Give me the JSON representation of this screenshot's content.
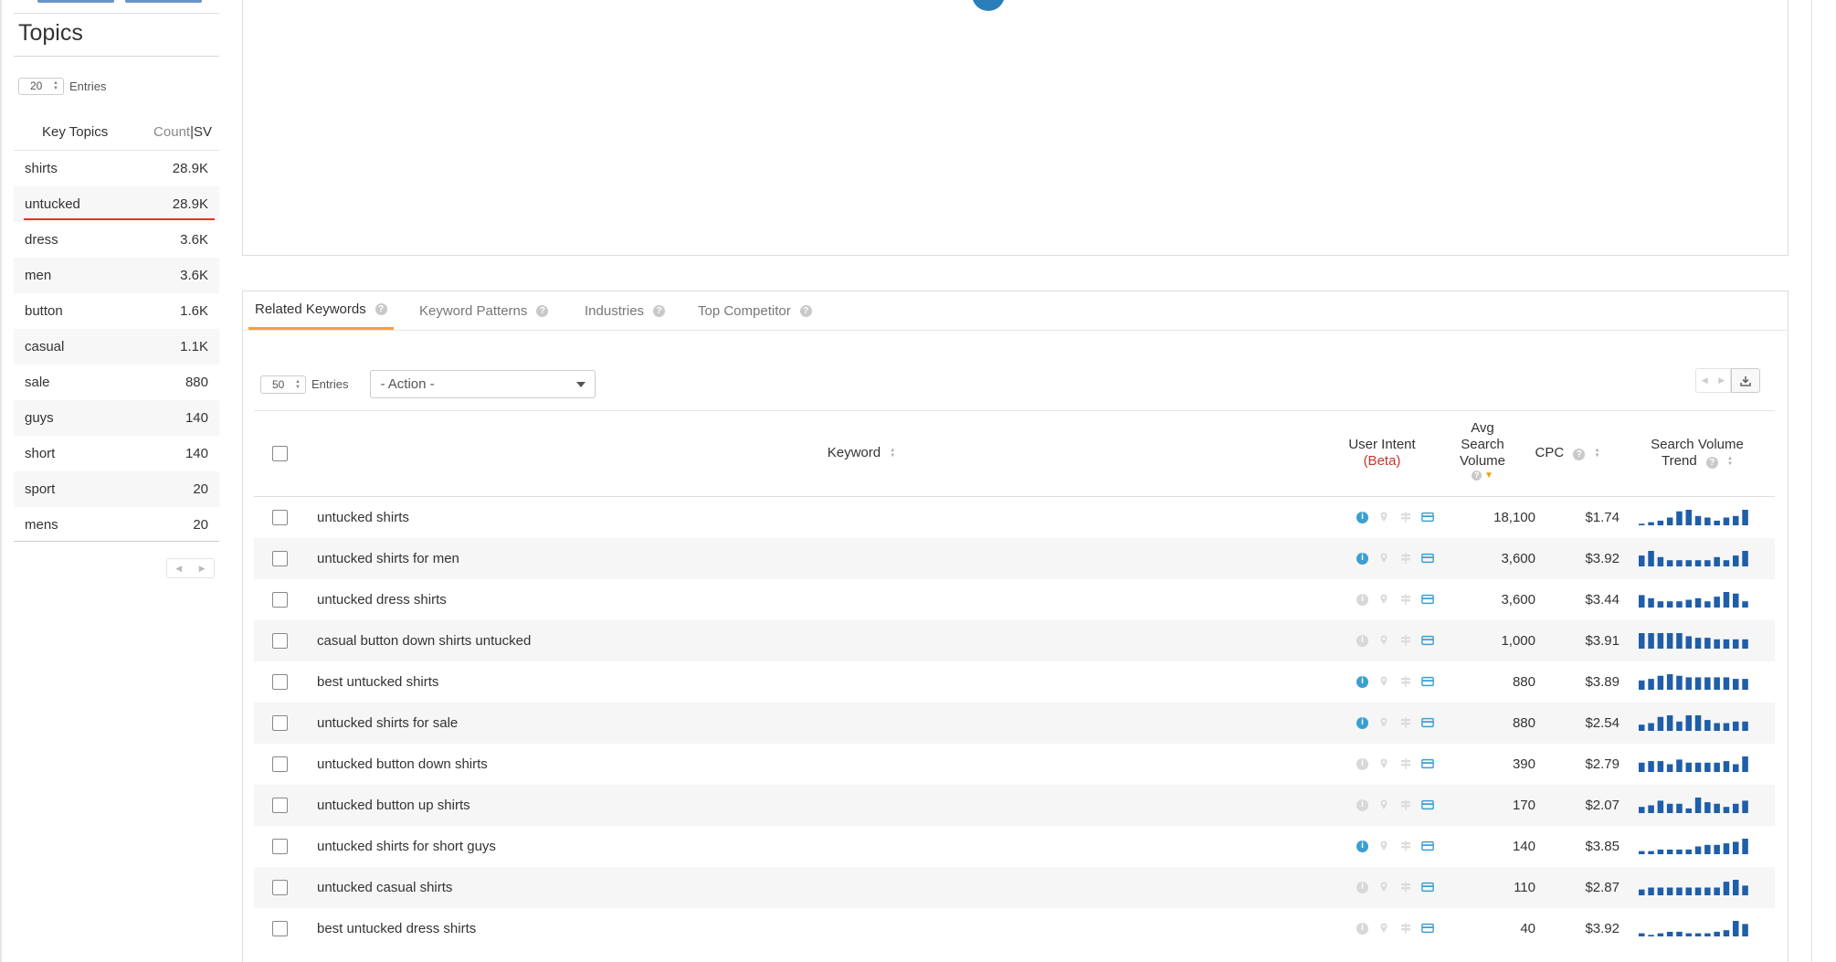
{
  "sidebar": {
    "title": "Topics",
    "entries_value": "20",
    "entries_label": "Entries",
    "col_key": "Key Topics",
    "col_count": "Count",
    "col_sep": "|",
    "col_sv": "SV",
    "topics": [
      {
        "name": "shirts",
        "count": "28.9K"
      },
      {
        "name": "untucked",
        "count": "28.9K",
        "highlight": true
      },
      {
        "name": "dress",
        "count": "3.6K"
      },
      {
        "name": "men",
        "count": "3.6K"
      },
      {
        "name": "button",
        "count": "1.6K"
      },
      {
        "name": "casual",
        "count": "1.1K"
      },
      {
        "name": "sale",
        "count": "880"
      },
      {
        "name": "guys",
        "count": "140"
      },
      {
        "name": "short",
        "count": "140"
      },
      {
        "name": "sport",
        "count": "20"
      },
      {
        "name": "mens",
        "count": "20"
      }
    ],
    "pager_prev": "◀",
    "pager_next": "▶"
  },
  "tabs": [
    {
      "label": "Related Keywords",
      "active": true
    },
    {
      "label": "Keyword Patterns"
    },
    {
      "label": "Industries"
    },
    {
      "label": "Top Competitor"
    }
  ],
  "controls": {
    "entries_value": "50",
    "entries_label": "Entries",
    "action_label": "- Action -"
  },
  "table": {
    "col_keyword": "Keyword",
    "col_intent": "User Intent",
    "col_intent_beta": "(Beta)",
    "col_avg_1": "Avg",
    "col_avg_2": "Search",
    "col_avg_3": "Volume",
    "col_cpc": "CPC",
    "col_trend_1": "Search Volume",
    "col_trend_2": "Trend",
    "rows": [
      {
        "keyword": "untucked shirts",
        "info": true,
        "volume": "18,100",
        "cpc": "$1.74",
        "trend": [
          1,
          2,
          3,
          5,
          9,
          10,
          6,
          5,
          3,
          5,
          6,
          10
        ]
      },
      {
        "keyword": "untucked shirts for men",
        "info": true,
        "volume": "3,600",
        "cpc": "$3.92",
        "trend": [
          7,
          10,
          6,
          4,
          4,
          4,
          4,
          4,
          6,
          4,
          7,
          10
        ]
      },
      {
        "keyword": "untucked dress shirts",
        "info": false,
        "volume": "3,600",
        "cpc": "$3.44",
        "trend": [
          8,
          6,
          4,
          4,
          4,
          5,
          6,
          4,
          7,
          10,
          9,
          4
        ]
      },
      {
        "keyword": "casual button down shirts untucked",
        "info": false,
        "volume": "1,000",
        "cpc": "$3.91",
        "trend": [
          10,
          10,
          10,
          10,
          10,
          8,
          7,
          7,
          6,
          6,
          6,
          6
        ]
      },
      {
        "keyword": "best untucked shirts",
        "info": true,
        "volume": "880",
        "cpc": "$3.89",
        "trend": [
          6,
          7,
          9,
          10,
          9,
          8,
          8,
          8,
          8,
          8,
          7,
          7
        ]
      },
      {
        "keyword": "untucked shirts for sale",
        "info": true,
        "volume": "880",
        "cpc": "$2.54",
        "trend": [
          4,
          5,
          9,
          10,
          6,
          10,
          10,
          7,
          5,
          5,
          6,
          6
        ]
      },
      {
        "keyword": "untucked button down shirts",
        "info": false,
        "volume": "390",
        "cpc": "$2.79",
        "trend": [
          6,
          7,
          7,
          5,
          8,
          6,
          6,
          6,
          6,
          7,
          5,
          10
        ]
      },
      {
        "keyword": "untucked button up shirts",
        "info": false,
        "volume": "170",
        "cpc": "$2.07",
        "trend": [
          4,
          5,
          8,
          6,
          6,
          3,
          10,
          7,
          6,
          4,
          6,
          8
        ]
      },
      {
        "keyword": "untucked shirts for short guys",
        "info": true,
        "volume": "140",
        "cpc": "$3.85",
        "trend": [
          2,
          2,
          3,
          3,
          3,
          3,
          5,
          6,
          6,
          7,
          8,
          10
        ]
      },
      {
        "keyword": "untucked casual shirts",
        "info": false,
        "volume": "110",
        "cpc": "$2.87",
        "trend": [
          3,
          4,
          4,
          4,
          4,
          4,
          4,
          4,
          4,
          7,
          8,
          5
        ]
      },
      {
        "keyword": "best untucked dress shirts",
        "info": false,
        "volume": "40",
        "cpc": "$3.92",
        "trend": [
          2,
          1,
          2,
          3,
          3,
          2,
          2,
          2,
          3,
          4,
          10,
          8
        ]
      }
    ]
  },
  "colors": {
    "accent": "#f0a23a",
    "highlight_underline": "#e8312a",
    "trend_bar": "#1f5ea8",
    "info_icon": "#3b9fd1",
    "card_icon": "#3b9fd1",
    "graph_node": "#2a7fba"
  },
  "icons": {
    "info": "i",
    "question": "?"
  }
}
